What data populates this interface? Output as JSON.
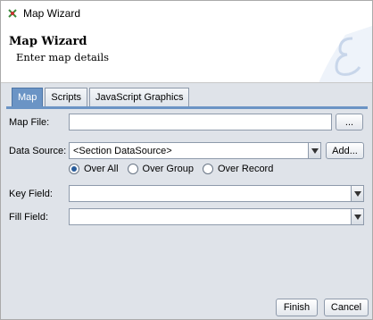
{
  "window": {
    "title": "Map Wizard"
  },
  "header": {
    "title": "Map Wizard",
    "subtitle": "Enter map details"
  },
  "tabs": [
    {
      "label": "Map",
      "active": true
    },
    {
      "label": "Scripts",
      "active": false
    },
    {
      "label": "JavaScript Graphics",
      "active": false
    }
  ],
  "form": {
    "map_file": {
      "label": "Map File:",
      "value": "",
      "browse_label": "..."
    },
    "data_source": {
      "label": "Data Source:",
      "value": "<Section DataSource>",
      "add_label": "Add..."
    },
    "scope": {
      "options": [
        {
          "label": "Over All",
          "selected": true
        },
        {
          "label": "Over Group",
          "selected": false
        },
        {
          "label": "Over Record",
          "selected": false
        }
      ]
    },
    "key_field": {
      "label": "Key Field:",
      "value": ""
    },
    "fill_field": {
      "label": "Fill Field:",
      "value": ""
    }
  },
  "footer": {
    "finish_label": "Finish",
    "cancel_label": "Cancel"
  },
  "colors": {
    "accent": "#6b94c5",
    "panel": "#dfe3e9"
  }
}
